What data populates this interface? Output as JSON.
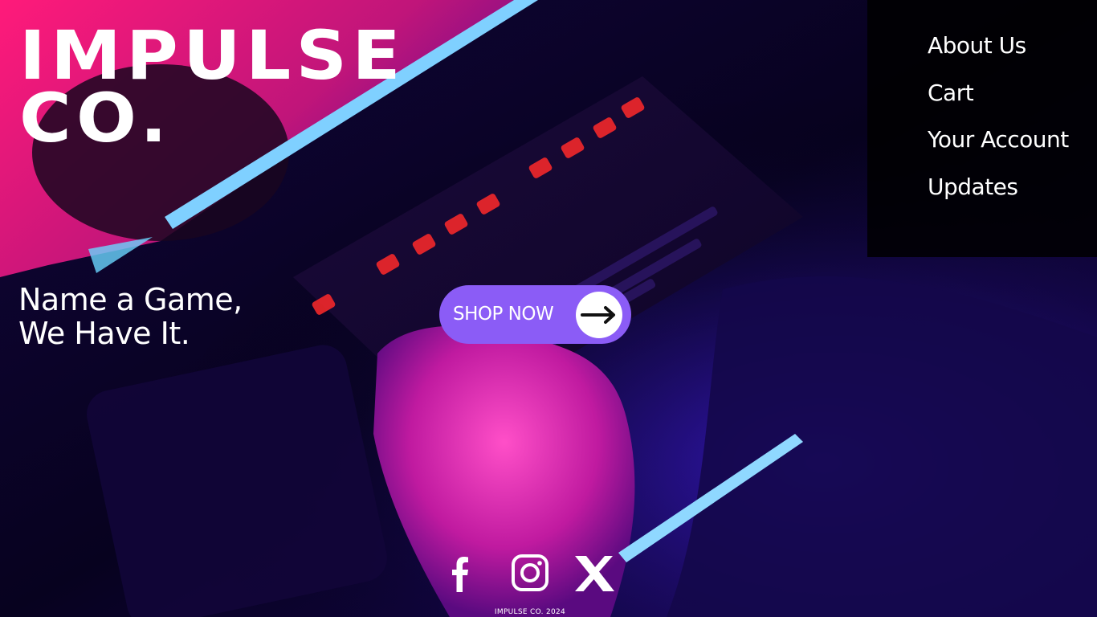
{
  "brand": {
    "name": "IMPULSE\nCO."
  },
  "nav": {
    "items": [
      {
        "label": "About Us"
      },
      {
        "label": "Cart"
      },
      {
        "label": "Your Account"
      },
      {
        "label": "Updates"
      }
    ]
  },
  "hero": {
    "tagline_line1": "Name a Game,",
    "tagline_line2": "We Have It.",
    "cta_label": "SHOP NOW",
    "cta_icon": "arrow-right-icon",
    "accent_color": "#8b5cf6"
  },
  "footer": {
    "social": [
      {
        "name": "facebook-icon"
      },
      {
        "name": "instagram-icon"
      },
      {
        "name": "x-icon"
      }
    ],
    "copyright": "IMPULSE CO. 2024"
  },
  "background": {
    "description_colors": [
      "#ff1f8e",
      "#5b1fff",
      "#0a0330",
      "#ff2020"
    ]
  }
}
